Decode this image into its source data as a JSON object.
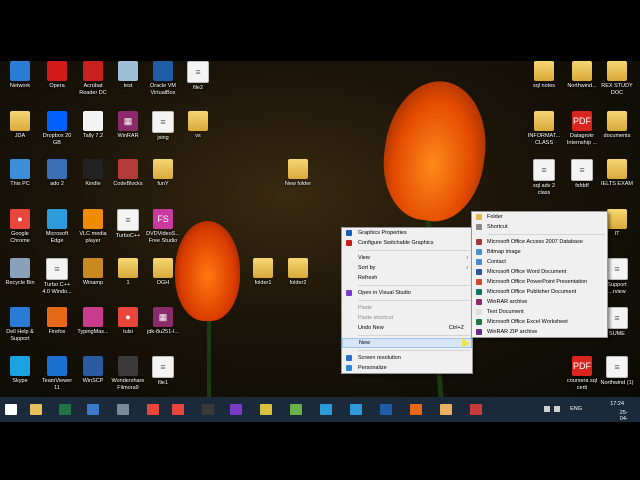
{
  "desktop_icons": [
    {
      "label": "Network",
      "icon": "network-icon",
      "color": "#2a7bd4"
    },
    {
      "label": "Opera",
      "icon": "opera-icon",
      "color": "#d11b1b"
    },
    {
      "label": "Acrobat Reader DC",
      "icon": "acrobat-icon",
      "color": "#c81f1f"
    },
    {
      "label": "test",
      "icon": "notepad-icon",
      "color": "#9fbfd8"
    },
    {
      "label": "Oracle VM VirtualBox",
      "icon": "virtualbox-icon",
      "color": "#1f5ca6"
    },
    {
      "label": "file2",
      "icon": "text-file-icon",
      "color": "#f4f4f4"
    },
    {
      "label": "JDA",
      "icon": "folder-icon",
      "color": "#e2b84a"
    },
    {
      "label": "Dropbox 20 GB",
      "icon": "dropbox-icon",
      "color": "#0061fe"
    },
    {
      "label": "Tally 7.2",
      "icon": "tally-icon",
      "color": "#f4f4f4"
    },
    {
      "label": "WinRAR",
      "icon": "winrar-icon",
      "color": "#8a2a6a"
    },
    {
      "label": "jsing",
      "icon": "document-icon",
      "color": "#f4f4f4"
    },
    {
      "label": "vs",
      "icon": "folder-icon",
      "color": "#e2b84a"
    },
    {
      "label": "This PC",
      "icon": "this-pc-icon",
      "color": "#3a8fd8"
    },
    {
      "label": "ado 2",
      "icon": "app-icon",
      "color": "#3a6fb8"
    },
    {
      "label": "Kindle",
      "icon": "kindle-icon",
      "color": "#222222"
    },
    {
      "label": "CodeBlocks",
      "icon": "codeblocks-icon",
      "color": "#b33a3a"
    },
    {
      "label": "funY",
      "icon": "folder-icon",
      "color": "#e2b84a"
    },
    {
      "label": "Google Chrome",
      "icon": "chrome-icon",
      "color": "#e8453c"
    },
    {
      "label": "Microsoft Edge",
      "icon": "edge-icon",
      "color": "#2c9adb"
    },
    {
      "label": "VLC media player",
      "icon": "vlc-icon",
      "color": "#f08a00"
    },
    {
      "label": "TurboC++",
      "icon": "document-icon",
      "color": "#f4f4f4"
    },
    {
      "label": "DVDVideoS... Free Studio",
      "icon": "dvdvideosoft-icon",
      "color": "#c83aa0"
    },
    {
      "label": "Recycle Bin",
      "icon": "recycle-bin-icon",
      "color": "#8aa0b8"
    },
    {
      "label": "Turbo C++ 4.0 Windo...",
      "icon": "document-icon",
      "color": "#f4f4f4"
    },
    {
      "label": "Winamp",
      "icon": "winamp-icon",
      "color": "#c88a20"
    },
    {
      "label": "1",
      "icon": "folder-icon",
      "color": "#e2b84a"
    },
    {
      "label": "OGH",
      "icon": "folder-icon",
      "color": "#e2b84a"
    },
    {
      "label": "Dell Help & Support",
      "icon": "dell-help-icon",
      "color": "#2a7bd4"
    },
    {
      "label": "Firefox",
      "icon": "firefox-icon",
      "color": "#e8681a"
    },
    {
      "label": "TypingMas...",
      "icon": "typingmaster-icon",
      "color": "#c83a8a"
    },
    {
      "label": "tulsi",
      "icon": "chrome-icon",
      "color": "#e8453c"
    },
    {
      "label": "jdk-8u251-l...",
      "icon": "winrar-icon",
      "color": "#8a2a6a"
    },
    {
      "label": "Skype",
      "icon": "skype-icon",
      "color": "#1aa3e0"
    },
    {
      "label": "TeamViewer 11",
      "icon": "teamviewer-icon",
      "color": "#1a6fd0"
    },
    {
      "label": "WinSCP",
      "icon": "winscp-icon",
      "color": "#2a5aa0"
    },
    {
      "label": "Wondershare Filmora9",
      "icon": "filmora-icon",
      "color": "#3a3a3a"
    },
    {
      "label": "file1",
      "icon": "text-file-icon",
      "color": "#f4f4f4"
    },
    {
      "label": "New folder",
      "icon": "folder-icon",
      "color": "#e2b84a"
    },
    {
      "label": "folder1",
      "icon": "folder-icon",
      "color": "#e2b84a"
    },
    {
      "label": "folder2",
      "icon": "folder-icon",
      "color": "#e2b84a"
    },
    {
      "label": "sql notes",
      "icon": "folder-icon",
      "color": "#e2b84a"
    },
    {
      "label": "Northwind...",
      "icon": "folder-icon",
      "color": "#e2b84a"
    },
    {
      "label": "REX STUDY DOC",
      "icon": "folder-icon",
      "color": "#e2b84a"
    },
    {
      "label": "INFORMAT... CLASS",
      "icon": "folder-icon",
      "color": "#e2b84a"
    },
    {
      "label": "Datagrokr Internship ...",
      "icon": "pdf-icon",
      "color": "#d8261e"
    },
    {
      "label": "documents",
      "icon": "folder-icon",
      "color": "#e2b84a"
    },
    {
      "label": "sql adv 2 class",
      "icon": "document-icon",
      "color": "#f4f4f4"
    },
    {
      "label": "fsfddf",
      "icon": "document-icon",
      "color": "#f4f4f4"
    },
    {
      "label": "IELTS EXAM",
      "icon": "folder-icon",
      "color": "#e2b84a"
    },
    {
      "label": "IT",
      "icon": "folder-icon",
      "color": "#e2b84a"
    },
    {
      "label": "Support ...rview",
      "icon": "document-icon",
      "color": "#f4f4f4"
    },
    {
      "label": "SUME",
      "icon": "document-icon",
      "color": "#f4f4f4"
    },
    {
      "label": "coursera sql certi",
      "icon": "pdf-icon",
      "color": "#d8261e"
    },
    {
      "label": "Northwind (1)",
      "icon": "document-icon",
      "color": "#f4f4f4"
    }
  ],
  "context_menu": {
    "items": [
      {
        "label": "Graphics Properties",
        "icon": "intel-graphics-icon",
        "color": "#1a5fb4"
      },
      {
        "label": "Configure Switchable Graphics",
        "icon": "amd-graphics-icon",
        "color": "#c81e1e"
      },
      {
        "label": "View",
        "arrow": "›"
      },
      {
        "label": "Sort by",
        "arrow": "›"
      },
      {
        "label": "Refresh"
      },
      {
        "label": "Open in Visual Studio",
        "icon": "visual-studio-icon",
        "color": "#7a3ac8"
      },
      {
        "label": "Paste",
        "disabled": true
      },
      {
        "label": "Paste shortcut",
        "disabled": true
      },
      {
        "label": "Undo New",
        "shortcut": "Ctrl+Z"
      },
      {
        "label": "New",
        "arrow": "›",
        "highlighted": true
      },
      {
        "label": "Screen resolution",
        "icon": "display-icon",
        "color": "#2a6fc8"
      },
      {
        "label": "Personalize",
        "icon": "personalize-icon",
        "color": "#2a8ad0"
      }
    ]
  },
  "new_submenu": {
    "items": [
      {
        "label": "Folder",
        "icon": "folder-icon",
        "color": "#e2b84a"
      },
      {
        "label": "Shortcut",
        "icon": "shortcut-icon",
        "color": "#8a8a8a"
      },
      {
        "label": "Microsoft Office Access 2007 Database",
        "icon": "access-icon",
        "color": "#a4373a"
      },
      {
        "label": "Bitmap image",
        "icon": "bitmap-icon",
        "color": "#4a90d0"
      },
      {
        "label": "Contact",
        "icon": "contact-icon",
        "color": "#4a8ad0"
      },
      {
        "label": "Microsoft Office Word Document",
        "icon": "word-icon",
        "color": "#2b579a"
      },
      {
        "label": "Microsoft Office PowerPoint Presentation",
        "icon": "powerpoint-icon",
        "color": "#d24726"
      },
      {
        "label": "Microsoft Office Publisher Document",
        "icon": "publisher-icon",
        "color": "#077568"
      },
      {
        "label": "WinRAR archive",
        "icon": "winrar-icon",
        "color": "#8a2a6a"
      },
      {
        "label": "Text Document",
        "icon": "text-file-icon",
        "color": "#dddddd"
      },
      {
        "label": "Microsoft Office Excel Worksheet",
        "icon": "excel-icon",
        "color": "#217346"
      },
      {
        "label": "WinRAR ZIP archive",
        "icon": "winrar-zip-icon",
        "color": "#6a2a8a"
      }
    ]
  },
  "taskbar": {
    "apps": [
      {
        "icon": "start-icon",
        "color": "#ffffff"
      },
      {
        "icon": "file-explorer-icon",
        "color": "#e8c060"
      },
      {
        "icon": "excel-icon",
        "color": "#217346"
      },
      {
        "icon": "network-app-icon",
        "color": "#3a7ac8"
      },
      {
        "icon": "calendar-icon",
        "color": "#7a8a9a"
      },
      {
        "icon": "chrome-icon",
        "color": "#e8453c"
      },
      {
        "icon": "chrome-icon",
        "color": "#e8453c"
      },
      {
        "icon": "kindle-icon",
        "color": "#3a3a3a"
      },
      {
        "icon": "visual-studio-icon",
        "color": "#7a3ac8"
      },
      {
        "icon": "sticky-icon",
        "color": "#d8c040"
      },
      {
        "icon": "notepadpp-icon",
        "color": "#6ab04a"
      },
      {
        "icon": "remote-icon",
        "color": "#2a9ad8"
      },
      {
        "icon": "edge-icon",
        "color": "#2c9adb"
      },
      {
        "icon": "virtualbox-icon",
        "color": "#1f5ca6"
      },
      {
        "icon": "firefox-icon",
        "color": "#e8681a"
      },
      {
        "icon": "paint-icon",
        "color": "#e8b060"
      },
      {
        "icon": "snipping-icon",
        "color": "#c83a3a"
      }
    ],
    "tray": {
      "lang": "ENG",
      "time": "17:24",
      "date": "25-04-2021"
    }
  }
}
